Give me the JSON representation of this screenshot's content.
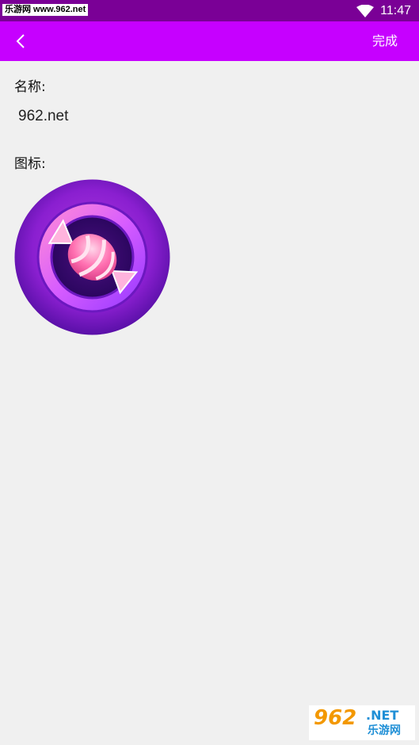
{
  "status_bar": {
    "watermark": "乐游网 www.962.net",
    "time": "11:47",
    "wifi_icon": "wifi-icon"
  },
  "nav": {
    "back_icon": "chevron-left-icon",
    "done_label": "完成"
  },
  "form": {
    "name_label": "名称:",
    "name_value": "962.net",
    "icon_label": "图标:",
    "app_icon": "candy-icon"
  },
  "watermark": {
    "num": "962",
    "net": ".NET",
    "cn": "乐游网"
  },
  "colors": {
    "status_bar": "#7a0096",
    "nav_bar": "#c600ff",
    "background": "#f0f0f0"
  }
}
